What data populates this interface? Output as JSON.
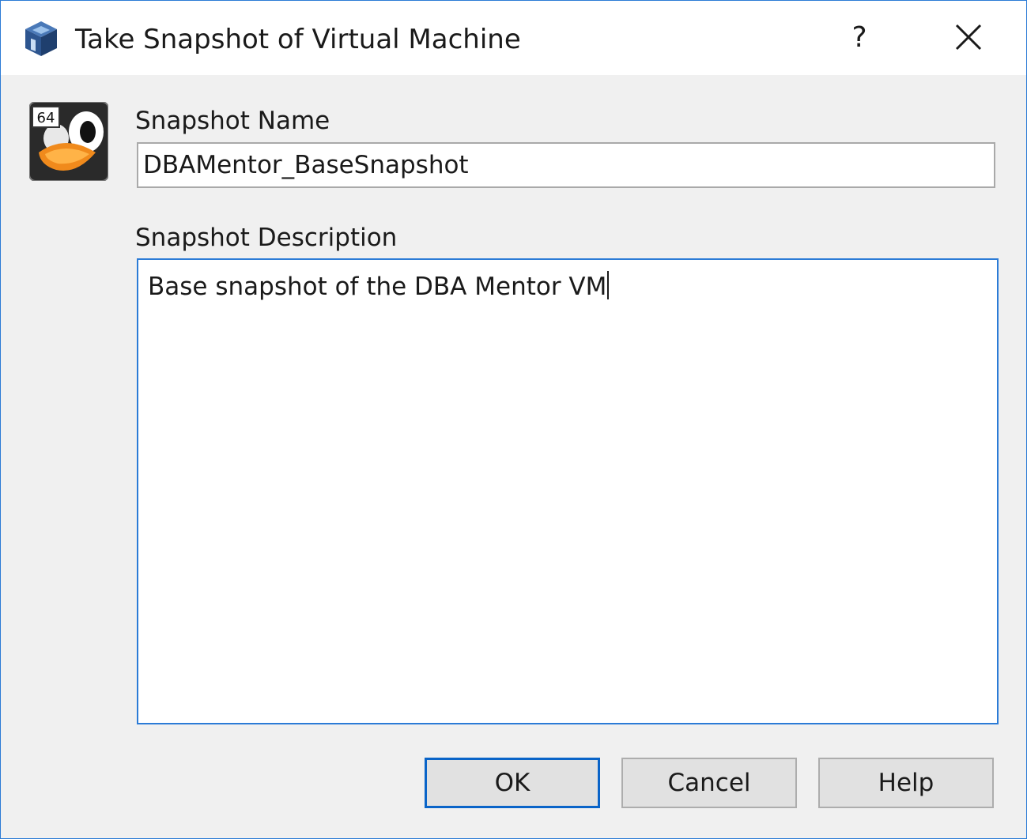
{
  "window": {
    "title": "Take Snapshot of Virtual Machine",
    "help_label": "?",
    "close_icon": "close-icon",
    "app_icon": "virtualbox-cube-icon",
    "accent_color": "#2b7bd6"
  },
  "form": {
    "vm_icon": "linux-64bit-penguin-icon",
    "vm_icon_badge": "64",
    "name_label": "Snapshot Name",
    "name_value": "DBAMentor_BaseSnapshot",
    "description_label": "Snapshot Description",
    "description_value": "Base snapshot of the DBA Mentor VM"
  },
  "buttons": {
    "ok_label": "OK",
    "cancel_label": "Cancel",
    "help_label": "Help"
  }
}
